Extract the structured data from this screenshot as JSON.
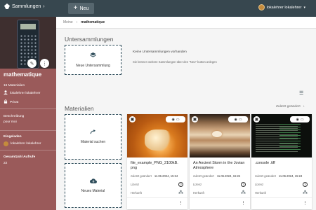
{
  "topbar": {
    "brand": "Sammlungen",
    "new_label": "Neu",
    "user": "lokalehrer lokalehrer"
  },
  "sidebar": {
    "title": "mathematique",
    "count": "16 Materialien",
    "owner": "lokalehrer lokalehrer",
    "scope": "Privat",
    "desc_label": "Beschreibung",
    "desc_value": "pour moi",
    "editors_label": "Eingeladen",
    "editor": "lokalehrer lokalehrer",
    "views_label": "Gesamtzahl Aufrufe",
    "views": "22"
  },
  "breadcrumb": {
    "home": "Meine",
    "current": "mathematique"
  },
  "subcollections": {
    "heading": "Untersammlungen",
    "new_label": "Neue Untersammlung",
    "empty_title": "Keine Untersammlungen vorhanden",
    "empty_hint": "Sie können weitere Sammlungen über den \"Neu\" button anlegen"
  },
  "materials": {
    "heading": "Materialien",
    "sort_label": "Zuletzt geändert",
    "search_label": "Material suchen",
    "new_label": "Neues Material",
    "cards": [
      {
        "title": "file_example_PNG_2100kB. png",
        "modified_label": "zuletzt geändert",
        "date": "11.06.2024, 15:24",
        "license_label": "Lizenz",
        "source_label": "Herkunft"
      },
      {
        "title": "An Ancient Storm in the Jovian Atmosphere",
        "modified_label": "zuletzt geändert",
        "date": "11.06.2024, 15:24",
        "license_label": "Lizenz",
        "source_label": "Herkunft"
      },
      {
        "title": ".console .tiff",
        "modified_label": "zuletzt geändert",
        "date": "11.06.2024, 15:24",
        "license_label": "Lizenz",
        "source_label": "Herkunft"
      }
    ]
  },
  "colors": {
    "topbar": "#37474f",
    "sidebar": "#9a5a5a",
    "accent": "#2c4b59"
  }
}
